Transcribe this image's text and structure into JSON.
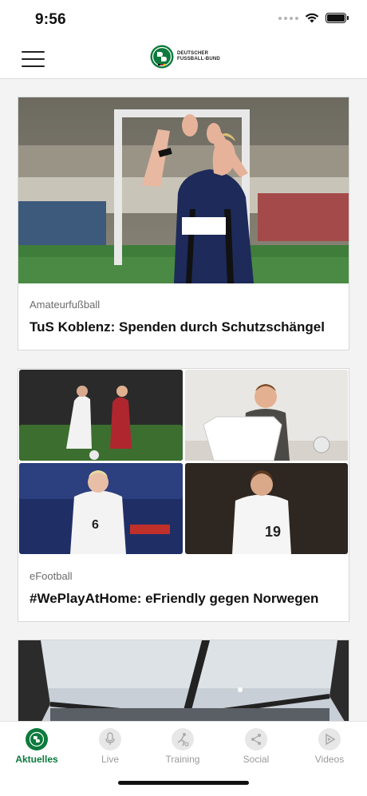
{
  "status_bar": {
    "time": "9:56"
  },
  "header": {
    "logo_line1": "DEUTSCHER",
    "logo_line2": "FUSSBALL-BUND",
    "brand_color": "#0c7a3c"
  },
  "feed": {
    "cards": [
      {
        "category": "Amateurfußball",
        "title": "TuS Koblenz: Spenden durch Schutzschängel",
        "image_icon": "photo-player-applauding"
      },
      {
        "category": "eFootball",
        "title": "#WePlayAtHome: eFriendly gegen Norwegen",
        "image_icon": "photo-collage-four-players"
      },
      {
        "category": "",
        "title": "",
        "image_icon": "photo-stadium-roof"
      }
    ]
  },
  "tabbar": {
    "items": [
      {
        "label": "Aktuelles",
        "icon": "dfb-logo-icon",
        "active": true
      },
      {
        "label": "Live",
        "icon": "microphone-icon",
        "active": false
      },
      {
        "label": "Training",
        "icon": "player-icon",
        "active": false
      },
      {
        "label": "Social",
        "icon": "share-icon",
        "active": false
      },
      {
        "label": "Videos",
        "icon": "play-icon",
        "active": false
      }
    ]
  }
}
